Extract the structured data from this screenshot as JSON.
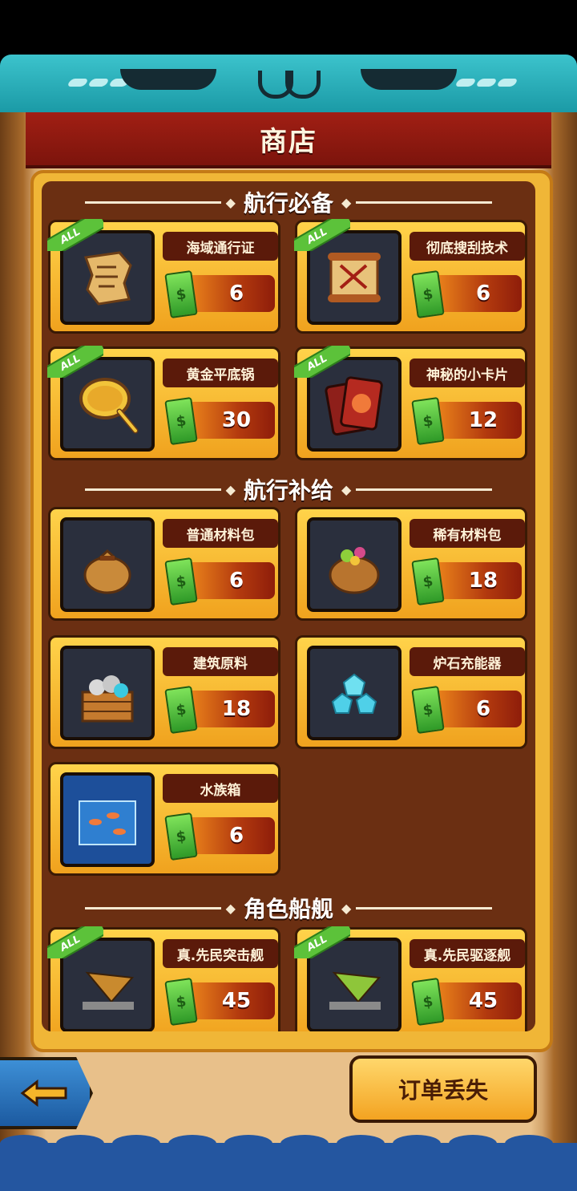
{
  "header": {
    "title": "商店"
  },
  "sections": [
    {
      "title": "航行必备",
      "items": [
        {
          "name": "海域通行证",
          "price": "6",
          "badge": "ALL",
          "icon": "map-icon"
        },
        {
          "name": "彻底搜刮技术",
          "price": "6",
          "badge": "ALL",
          "icon": "scroll-icon"
        },
        {
          "name": "黄金平底锅",
          "price": "30",
          "badge": "ALL",
          "icon": "pan-icon"
        },
        {
          "name": "神秘的小卡片",
          "price": "12",
          "badge": "ALL",
          "icon": "cards-icon"
        }
      ]
    },
    {
      "title": "航行补给",
      "items": [
        {
          "name": "普通材料包",
          "price": "6",
          "icon": "sack-icon"
        },
        {
          "name": "稀有材料包",
          "price": "18",
          "icon": "rare-sack-icon"
        },
        {
          "name": "建筑原料",
          "price": "18",
          "icon": "crate-icon"
        },
        {
          "name": "炉石充能器",
          "price": "6",
          "icon": "crystal-icon"
        },
        {
          "name": "水族箱",
          "price": "6",
          "icon": "aquarium-icon"
        }
      ]
    },
    {
      "title": "角色船舰",
      "items": [
        {
          "name": "真.先民突击舰",
          "price": "45",
          "badge": "ALL",
          "icon": "ship-orange-icon"
        },
        {
          "name": "真.先民驱逐舰",
          "price": "45",
          "badge": "ALL",
          "icon": "ship-green-icon"
        }
      ]
    }
  ],
  "footer": {
    "order_lost_label": "订单丢失"
  },
  "colors": {
    "accent": "#f0b637",
    "panel": "#6b2f12",
    "banner": "#a11f14"
  }
}
